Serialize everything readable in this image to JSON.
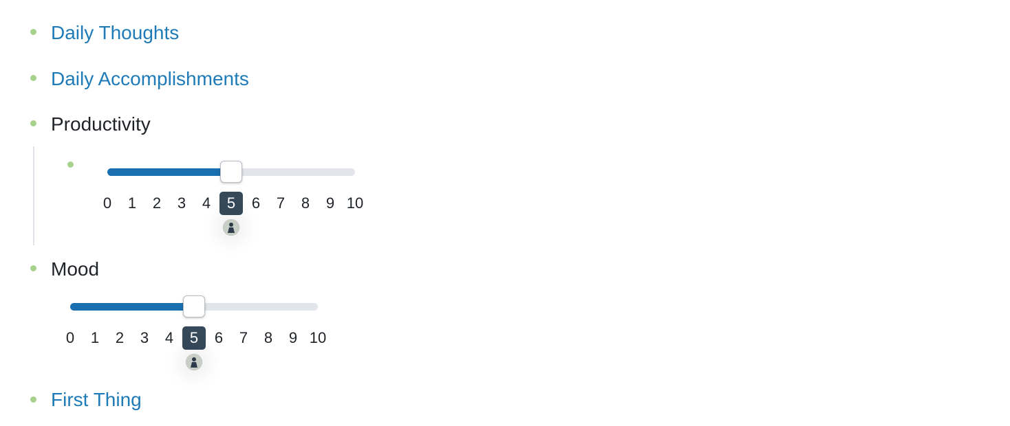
{
  "items": [
    {
      "label": "Daily Thoughts",
      "type": "link"
    },
    {
      "label": "Daily Accomplishments",
      "type": "link"
    },
    {
      "label": "Productivity",
      "type": "text"
    },
    {
      "label": "Mood",
      "type": "text"
    },
    {
      "label": "First Thing",
      "type": "link"
    }
  ],
  "sliders": {
    "productivity": {
      "value": 5,
      "min": 0,
      "max": 10,
      "ticks": [
        "0",
        "1",
        "2",
        "3",
        "4",
        "5",
        "6",
        "7",
        "8",
        "9",
        "10"
      ]
    },
    "mood": {
      "value": 5,
      "min": 0,
      "max": 10,
      "ticks": [
        "0",
        "1",
        "2",
        "3",
        "4",
        "5",
        "6",
        "7",
        "8",
        "9",
        "10"
      ]
    }
  },
  "colors": {
    "bullet": "#a9d18e",
    "link": "#1f7bb8",
    "slider_fill": "#1a6fb0",
    "slider_track": "#e2e5e9",
    "active_tick_bg": "#36495b"
  },
  "icons": {
    "avatar": "user-avatar-icon"
  }
}
